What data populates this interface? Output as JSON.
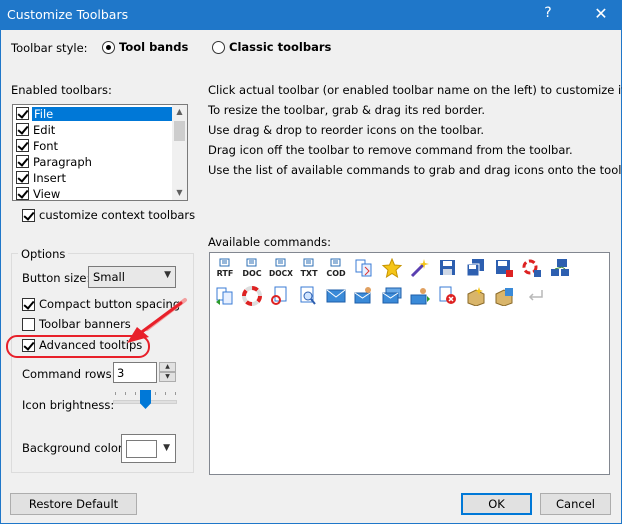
{
  "window": {
    "title": "Customize Toolbars",
    "help_glyph": "?",
    "close_glyph": "✕"
  },
  "toolbar_style": {
    "label": "Toolbar style:",
    "options": [
      {
        "label": "Tool bands",
        "selected": true
      },
      {
        "label": "Classic toolbars",
        "selected": false
      }
    ]
  },
  "enabled_toolbars": {
    "label": "Enabled toolbars:",
    "items": [
      {
        "label": "File",
        "checked": true,
        "selected": true
      },
      {
        "label": "Edit",
        "checked": true,
        "selected": false
      },
      {
        "label": "Font",
        "checked": true,
        "selected": false
      },
      {
        "label": "Paragraph",
        "checked": true,
        "selected": false
      },
      {
        "label": "Insert",
        "checked": true,
        "selected": false
      },
      {
        "label": "View",
        "checked": true,
        "selected": false
      }
    ],
    "customize_context": {
      "label": "customize context toolbars",
      "checked": true
    }
  },
  "instructions": [
    "Click actual toolbar (or enabled toolbar name on the left) to customize it.",
    "To resize the toolbar, grab & drag its red border.",
    "Use drag & drop to reorder icons on the toolbar.",
    "Drag icon off the toolbar to remove command from the toolbar.",
    "Use the list of available commands to grab and drag icons onto the toolbar."
  ],
  "options": {
    "title": "Options",
    "button_size": {
      "label": "Button size:",
      "value": "Small"
    },
    "compact_spacing": {
      "label": "Compact button spacing",
      "checked": true
    },
    "toolbar_banners": {
      "label": "Toolbar banners",
      "checked": false
    },
    "advanced_tooltips": {
      "label": "Advanced tooltips",
      "checked": true
    },
    "command_rows": {
      "label": "Command rows:",
      "value": "3"
    },
    "icon_brightness": {
      "label": "Icon brightness:",
      "level": 0.5
    },
    "background_color": {
      "label": "Background color:",
      "value": "#ffffff"
    }
  },
  "available_commands": {
    "label": "Available commands:",
    "row1": [
      {
        "name": "rtf-icon",
        "text": "RTF"
      },
      {
        "name": "doc-icon",
        "text": "DOC"
      },
      {
        "name": "docx-icon",
        "text": "DOCX"
      },
      {
        "name": "txt-icon",
        "text": "TXT"
      },
      {
        "name": "cod-icon",
        "text": "COD"
      }
    ],
    "row1_icons": [
      "compare-docs-icon",
      "star-icon",
      "magic-wand-icon",
      "save-icon",
      "save-all-icon",
      "save-red-icon",
      "sync-icon",
      "network-save-icon"
    ],
    "row2_icons": [
      "copy-docs-icon",
      "lifebuoy-icon",
      "page-refresh-icon",
      "preview-icon",
      "email-icon",
      "email-user-icon",
      "email-stack-icon",
      "send-user-icon",
      "delete-doc-icon",
      "new-box-icon",
      "export-box-icon",
      "return-icon"
    ]
  },
  "buttons": {
    "restore": "Restore Default",
    "ok": "OK",
    "cancel": "Cancel"
  },
  "colors": {
    "titlebar": "#1f77c9",
    "selection": "#0078d7",
    "highlight": "#e8202a"
  }
}
